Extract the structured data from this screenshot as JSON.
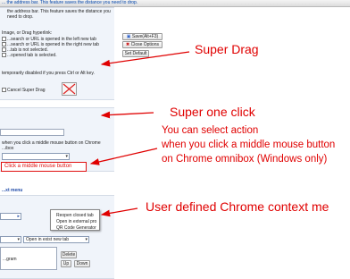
{
  "top": {
    "tab_title": "... the address bar. This feature saves the distance you need to drop."
  },
  "drag_section": {
    "lines": [
      "the address bar. This feature saves the distance you",
      "need to drop."
    ],
    "options": [
      "Image, or Drag hyperlink:",
      "...search or URL is opened in the left new tab",
      "...search or URL is opened in the right new tab",
      "...tab is not selected.",
      "...opened tab is selected."
    ],
    "temp_disable": "temporarily disabled if you press Ctrl or Alt key.",
    "cancel_label": "Cancel Super Drag",
    "buttons": {
      "save_f3": "Save(Alt+F3)",
      "close_options": "Close Options",
      "set_default": "Set Default"
    }
  },
  "click_section": {
    "desc_1": "when you click a middle mouse button on Chrome",
    "desc_2": "...ibox",
    "highlight": "Click a middle mouse button"
  },
  "context_section": {
    "title": "...xt menu",
    "menu_items": [
      "Reopen closed tab",
      "Open in external pro",
      "QR Code Generator"
    ],
    "open_select": "Open in exist new tab",
    "program_label": "...gram",
    "buttons": {
      "delete": "Delete",
      "up": "Up",
      "down": "Down"
    }
  },
  "annotations": {
    "super_drag": "Super Drag",
    "super_one_click": "Super one click",
    "click_desc": [
      "You can select action",
      "when you click a middle mouse button",
      "on Chrome omnibox (Windows only)"
    ],
    "context_menu": "User defined Chrome context me"
  },
  "colors": {
    "annotation": "#e00000",
    "section_bg": "#f0f4fa",
    "section_title": "#1f4aa8"
  }
}
